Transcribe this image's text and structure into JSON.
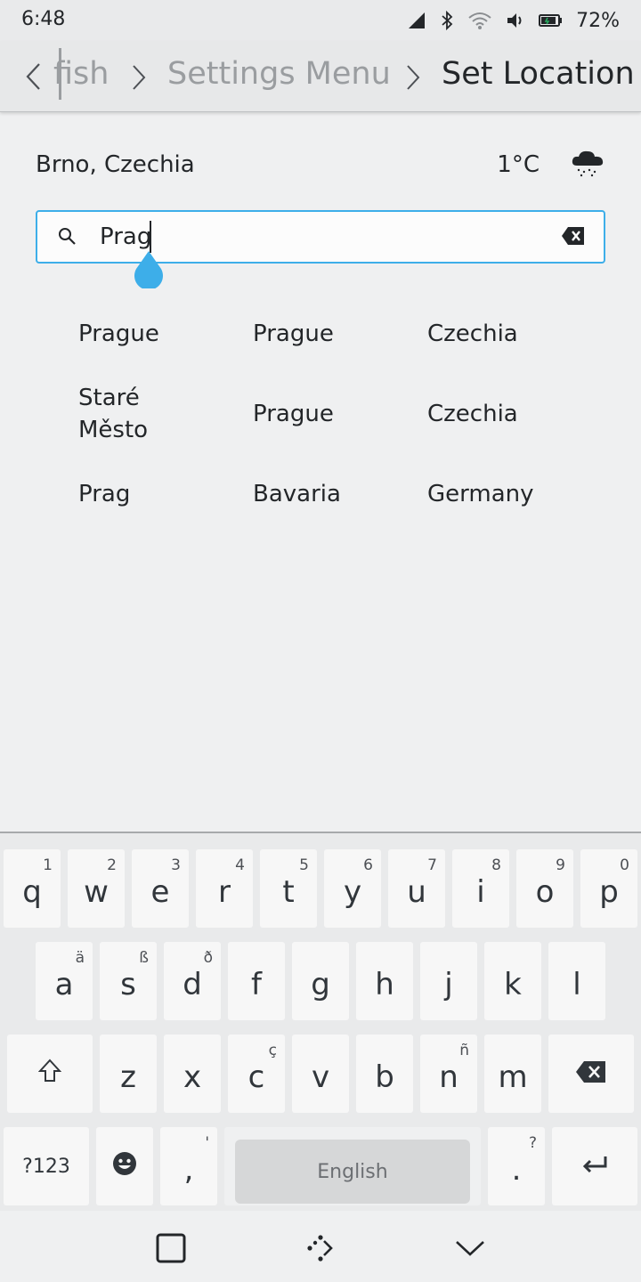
{
  "status_bar": {
    "time": "6:48",
    "battery_percent": "72%",
    "icons": [
      "signal-icon",
      "bluetooth-icon",
      "wifi-icon",
      "volume-icon",
      "battery-icon"
    ]
  },
  "breadcrumb": {
    "items": [
      "fish",
      "Settings Menu",
      "Set Location"
    ]
  },
  "current_location": {
    "city": "Brno, Czechia",
    "temperature": "1°C",
    "weather_icon": "cloud-snow-icon"
  },
  "search": {
    "value": "Prag"
  },
  "results": [
    {
      "name": "Prague",
      "region": "Prague",
      "country": "Czechia"
    },
    {
      "name": "Staré Město",
      "region": "Prague",
      "country": "Czechia"
    },
    {
      "name": "Prag",
      "region": "Bavaria",
      "country": "Germany"
    }
  ],
  "keyboard": {
    "row1": [
      {
        "key": "q",
        "hint": "1"
      },
      {
        "key": "w",
        "hint": "2"
      },
      {
        "key": "e",
        "hint": "3"
      },
      {
        "key": "r",
        "hint": "4"
      },
      {
        "key": "t",
        "hint": "5"
      },
      {
        "key": "y",
        "hint": "6"
      },
      {
        "key": "u",
        "hint": "7"
      },
      {
        "key": "i",
        "hint": "8"
      },
      {
        "key": "o",
        "hint": "9"
      },
      {
        "key": "p",
        "hint": "0"
      }
    ],
    "row2": [
      {
        "key": "a",
        "hint": "ä"
      },
      {
        "key": "s",
        "hint": "ß"
      },
      {
        "key": "d",
        "hint": "ð"
      },
      {
        "key": "f",
        "hint": ""
      },
      {
        "key": "g",
        "hint": ""
      },
      {
        "key": "h",
        "hint": ""
      },
      {
        "key": "j",
        "hint": ""
      },
      {
        "key": "k",
        "hint": ""
      },
      {
        "key": "l",
        "hint": ""
      }
    ],
    "row3": [
      {
        "key": "z",
        "hint": ""
      },
      {
        "key": "x",
        "hint": ""
      },
      {
        "key": "c",
        "hint": "ç"
      },
      {
        "key": "v",
        "hint": ""
      },
      {
        "key": "b",
        "hint": ""
      },
      {
        "key": "n",
        "hint": "ñ"
      },
      {
        "key": "m",
        "hint": ""
      }
    ],
    "symbols_label": "?123",
    "comma": ",",
    "comma_hint": "'",
    "space_label": "English",
    "period": ".",
    "period_hint": "?"
  },
  "accent_color": "#3daee9"
}
